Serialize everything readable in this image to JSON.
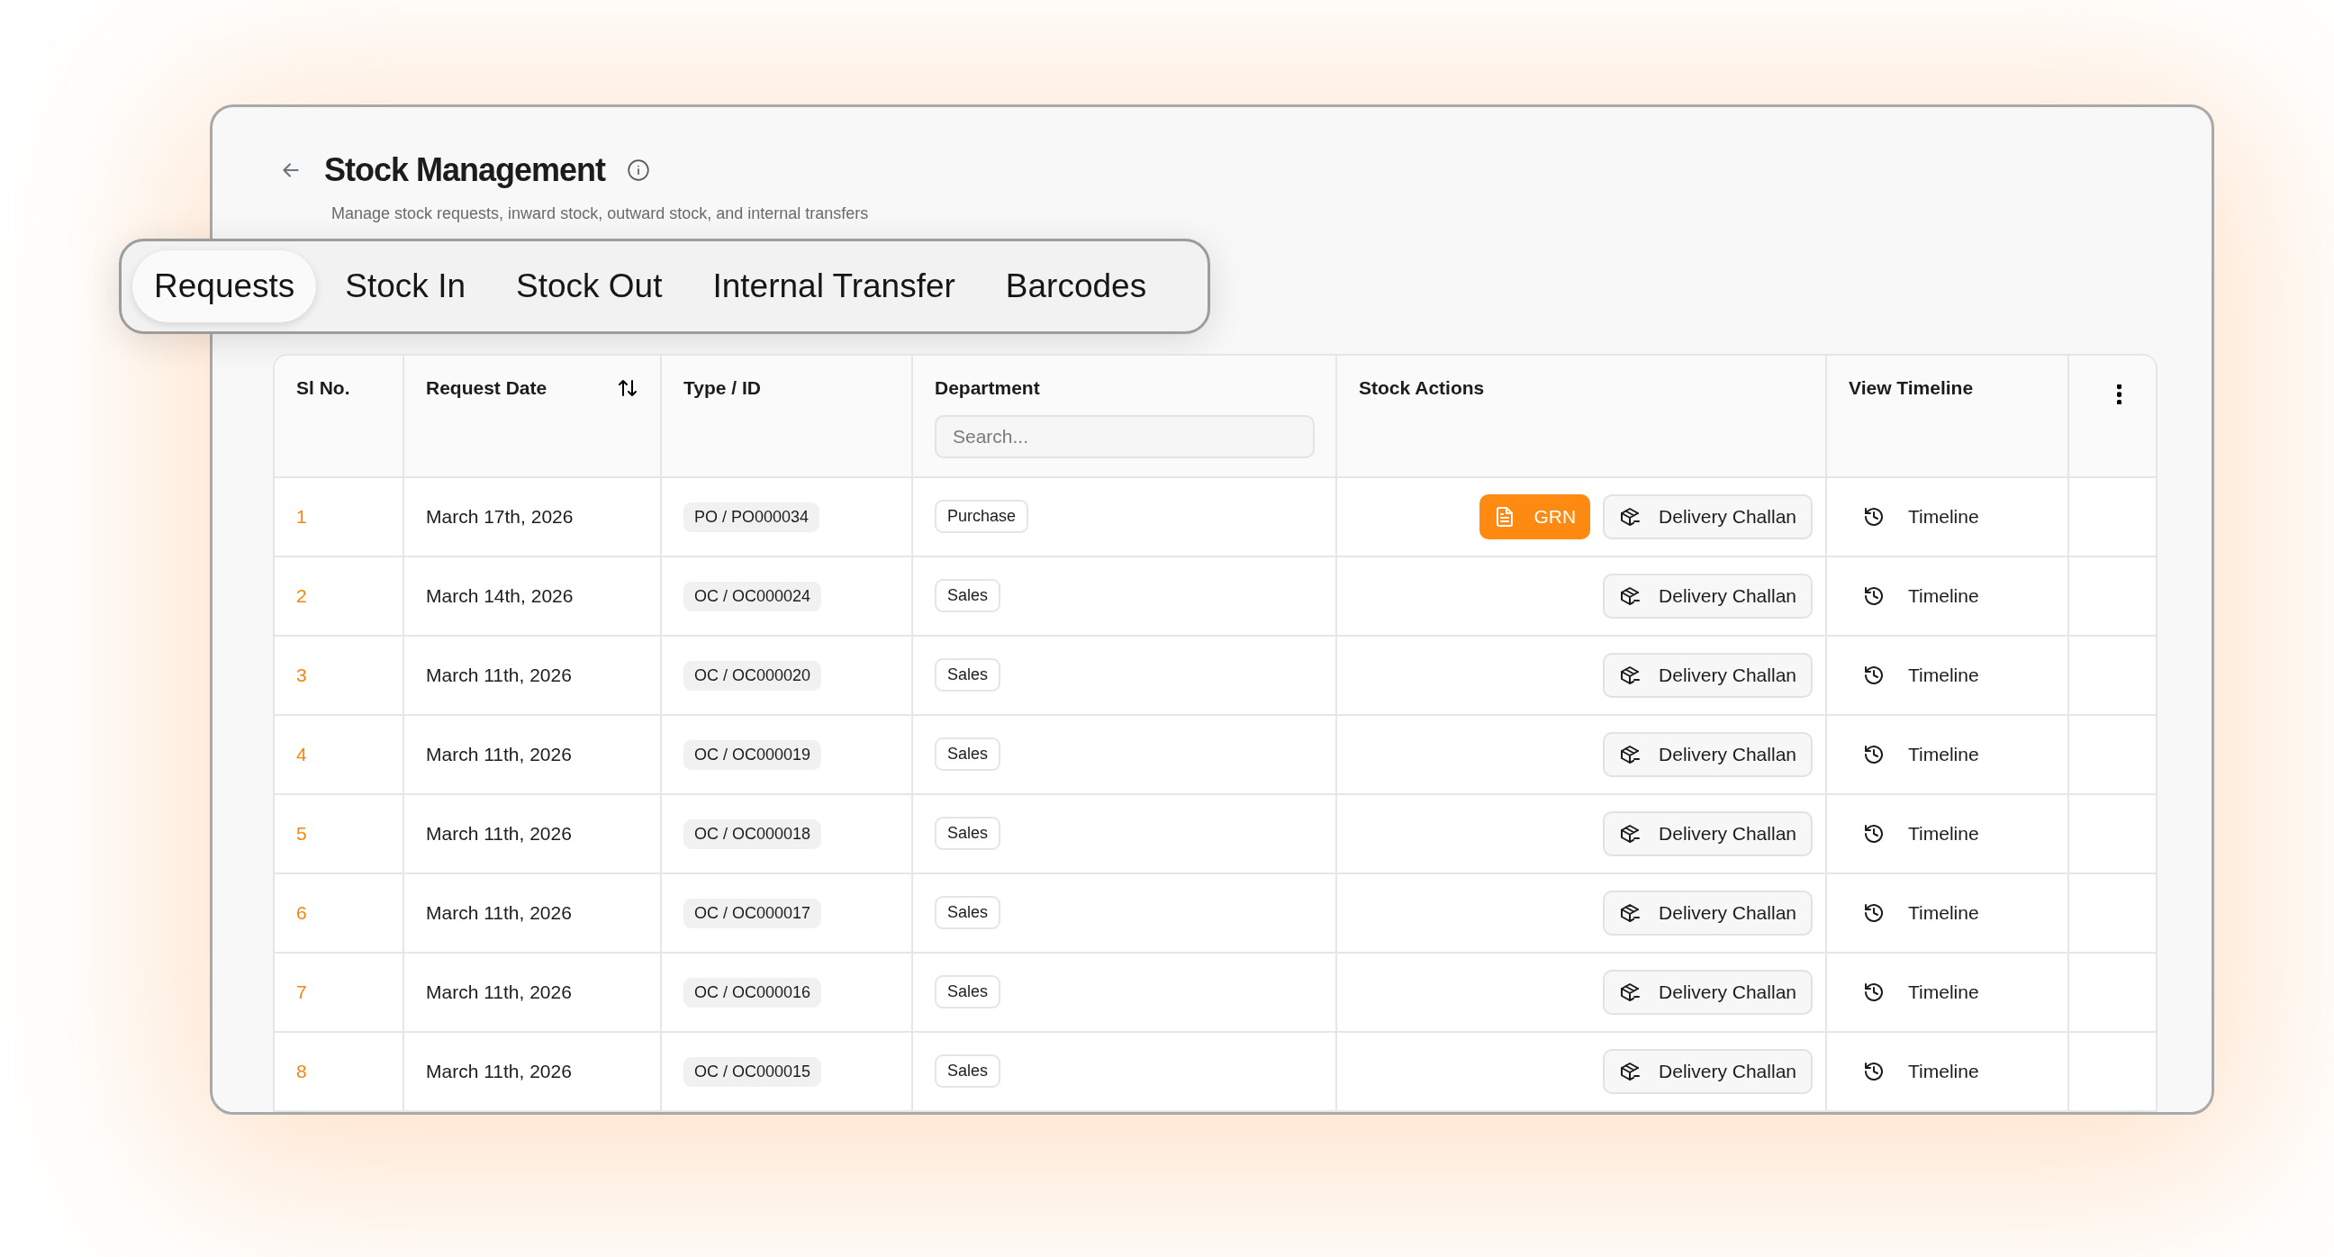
{
  "header": {
    "title": "Stock Management",
    "subtitle": "Manage stock requests, inward stock, outward stock, and internal transfers"
  },
  "tabs": [
    {
      "label": "Requests",
      "selected": true
    },
    {
      "label": "Stock In",
      "selected": false
    },
    {
      "label": "Stock Out",
      "selected": false
    },
    {
      "label": "Internal Transfer",
      "selected": false
    },
    {
      "label": "Barcodes",
      "selected": false
    }
  ],
  "table": {
    "columns": [
      {
        "label": "Sl No.",
        "sortable": false
      },
      {
        "label": "Request Date",
        "sortable": true
      },
      {
        "label": "Type / ID",
        "sortable": false
      },
      {
        "label": "Department",
        "sortable": false,
        "filter": {
          "placeholder": "Search..."
        }
      },
      {
        "label": "Stock Actions",
        "sortable": false
      },
      {
        "label": "View Timeline",
        "sortable": false
      },
      {
        "kind": "menu"
      }
    ],
    "rows": [
      {
        "sl_no": "1",
        "request_date": "March 17th, 2026",
        "type_id": "PO / PO000034",
        "department": "Purchase",
        "actions": [
          {
            "kind": "primary",
            "label": "GRN"
          },
          {
            "kind": "secondary",
            "label": "Delivery Challan"
          }
        ],
        "timeline": "Timeline"
      },
      {
        "sl_no": "2",
        "request_date": "March 14th, 2026",
        "type_id": "OC / OC000024",
        "department": "Sales",
        "actions": [
          {
            "kind": "secondary",
            "label": "Delivery Challan"
          }
        ],
        "timeline": "Timeline"
      },
      {
        "sl_no": "3",
        "request_date": "March 11th, 2026",
        "type_id": "OC / OC000020",
        "department": "Sales",
        "actions": [
          {
            "kind": "secondary",
            "label": "Delivery Challan"
          }
        ],
        "timeline": "Timeline"
      },
      {
        "sl_no": "4",
        "request_date": "March 11th, 2026",
        "type_id": "OC / OC000019",
        "department": "Sales",
        "actions": [
          {
            "kind": "secondary",
            "label": "Delivery Challan"
          }
        ],
        "timeline": "Timeline"
      },
      {
        "sl_no": "5",
        "request_date": "March 11th, 2026",
        "type_id": "OC / OC000018",
        "department": "Sales",
        "actions": [
          {
            "kind": "secondary",
            "label": "Delivery Challan"
          }
        ],
        "timeline": "Timeline"
      },
      {
        "sl_no": "6",
        "request_date": "March 11th, 2026",
        "type_id": "OC / OC000017",
        "department": "Sales",
        "actions": [
          {
            "kind": "secondary",
            "label": "Delivery Challan"
          }
        ],
        "timeline": "Timeline"
      },
      {
        "sl_no": "7",
        "request_date": "March 11th, 2026",
        "type_id": "OC / OC000016",
        "department": "Sales",
        "actions": [
          {
            "kind": "secondary",
            "label": "Delivery Challan"
          }
        ],
        "timeline": "Timeline"
      },
      {
        "sl_no": "8",
        "request_date": "March 11th, 2026",
        "type_id": "OC / OC000015",
        "department": "Sales",
        "actions": [
          {
            "kind": "secondary",
            "label": "Delivery Challan"
          }
        ],
        "timeline": "Timeline"
      }
    ]
  }
}
